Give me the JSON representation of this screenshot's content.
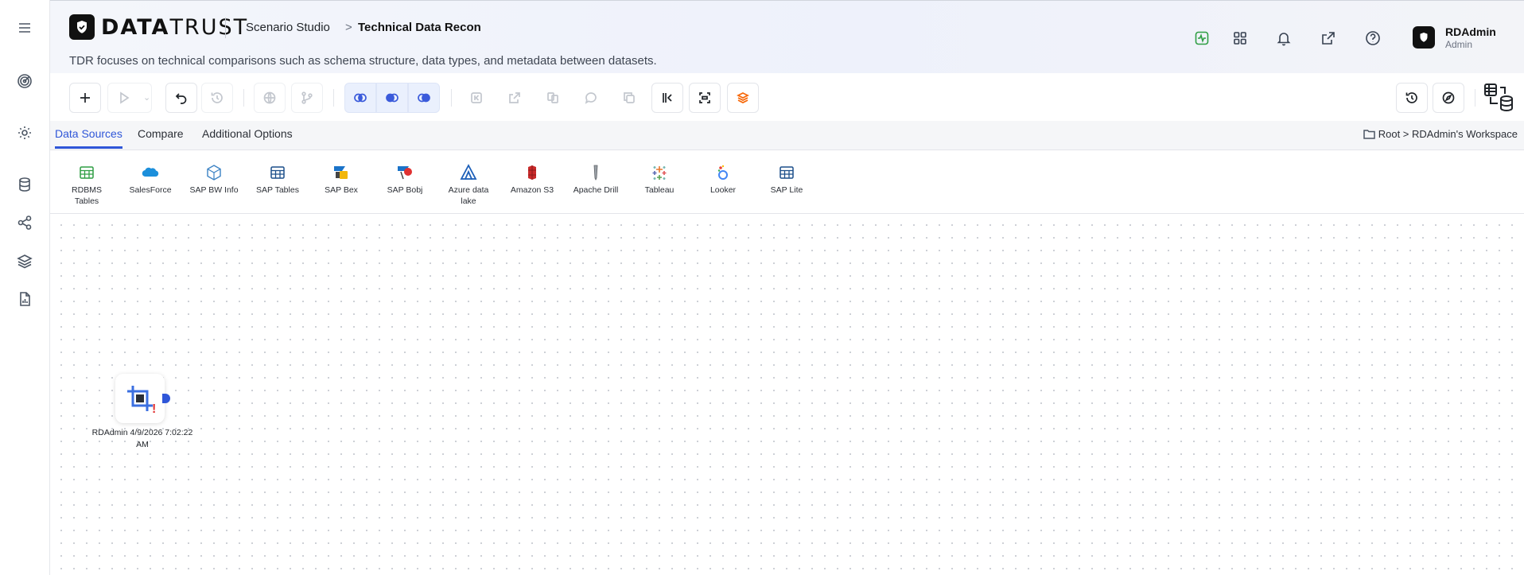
{
  "brand": {
    "name_bold": "DATA",
    "name_light": "TRUST"
  },
  "breadcrumb": {
    "studio": "Scenario Studio",
    "separator": ">",
    "page": "Technical Data Recon"
  },
  "subtitle": "TDR focuses on technical comparisons such as schema structure, data types, and metadata between datasets.",
  "user": {
    "name": "RDAdmin",
    "role": "Admin"
  },
  "tabs": [
    {
      "label": "Data Sources",
      "active": true
    },
    {
      "label": "Compare",
      "active": false
    },
    {
      "label": "Additional Options",
      "active": false
    }
  ],
  "workspace": {
    "path": "Root > RDAdmin's Workspace"
  },
  "sources": [
    {
      "label": "RDBMS Tables",
      "icon": "table-icon"
    },
    {
      "label": "SalesForce",
      "icon": "salesforce-icon"
    },
    {
      "label": "SAP BW Info",
      "icon": "cube-icon"
    },
    {
      "label": "SAP Tables",
      "icon": "table-icon"
    },
    {
      "label": "SAP Bex",
      "icon": "sap-bex-icon"
    },
    {
      "label": "SAP Bobj",
      "icon": "sap-bobj-icon"
    },
    {
      "label": "Azure data lake",
      "icon": "azure-icon"
    },
    {
      "label": "Amazon S3",
      "icon": "s3-icon"
    },
    {
      "label": "Apache Drill",
      "icon": "drill-icon"
    },
    {
      "label": "Tableau",
      "icon": "tableau-icon"
    },
    {
      "label": "Looker",
      "icon": "looker-icon"
    },
    {
      "label": "SAP Lite",
      "icon": "table-icon"
    }
  ],
  "node": {
    "label": "RDAdmin 4/9/2026 7:02:22 AM",
    "warning": "!"
  },
  "colors": {
    "accent": "#2f56d8",
    "warning": "#e03131"
  }
}
